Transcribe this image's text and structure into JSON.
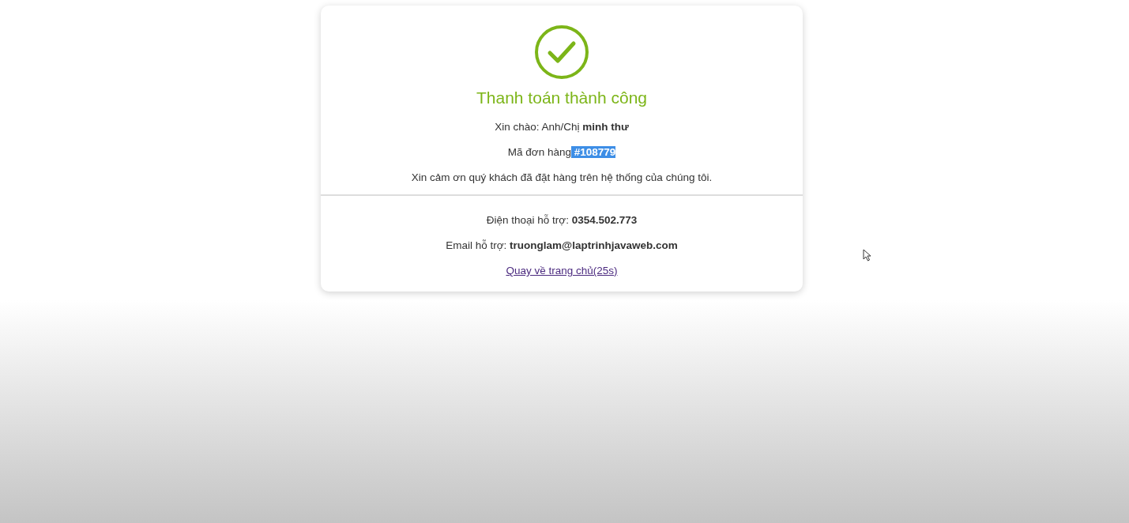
{
  "title": "Thanh toán thành công",
  "greeting": "Xin chào: Anh/Chị **minh thư**",
  "order": {
    "label": "Mã đơn hàng",
    "number": " #108779",
    "highlighted": true
  },
  "thanks": "Xin cảm ơn quý khách đã đặt hàng trên hệ thống của chúng tôi.",
  "support": [
    "Điện thoại hỗ trợ: **0354.502.773**",
    "Email hỗ trợ: **truonglam@laptrinhjavaweb.com**"
  ],
  "home_link": "Quay về trang chủ(25s)"
}
